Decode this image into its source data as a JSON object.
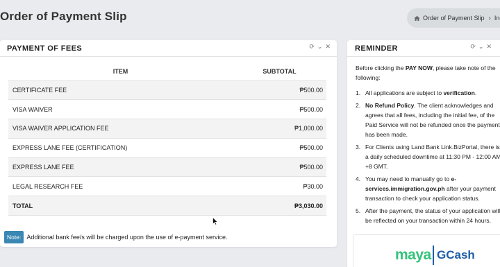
{
  "header": {
    "title": "Order of Payment Slip",
    "breadcrumb": [
      "Order of Payment Slip",
      "Inde"
    ]
  },
  "fees_panel": {
    "title": "PAYMENT OF FEES",
    "columns": [
      "ITEM",
      "SUBTOTAL"
    ],
    "rows": [
      {
        "item": "CERTIFICATE FEE",
        "subtotal": "₱500.00"
      },
      {
        "item": "VISA WAIVER",
        "subtotal": "₱500.00"
      },
      {
        "item": "VISA WAIVER APPLICATION FEE",
        "subtotal": "₱1,000.00"
      },
      {
        "item": "EXPRESS LANE FEE (CERTIFICATION)",
        "subtotal": "₱500.00"
      },
      {
        "item": "EXPRESS LANE FEE",
        "subtotal": "₱500.00"
      },
      {
        "item": "LEGAL RESEARCH FEE",
        "subtotal": "₱30.00"
      }
    ],
    "total": {
      "label": "TOTAL",
      "value": "₱3,030.00"
    },
    "note_badge": "Note:",
    "note_text": "Additional bank fee/s will be charged upon the use of e-payment service."
  },
  "reminder_panel": {
    "title": "REMINDER",
    "intro_a": "Before clicking the ",
    "intro_bold": "PAY NOW",
    "intro_b": ", please take note of the following:",
    "items": [
      {
        "num": "1.",
        "a": "All applications are subject to ",
        "b": "verification",
        "c": "."
      },
      {
        "num": "2.",
        "a": "",
        "b": "No Refund Policy",
        "c": ". The client acknowledges and agrees that all fees, including the initial fee, of the Paid Service will not be refunded once the payment has been made."
      },
      {
        "num": "3.",
        "a": "For Clients using Land Bank Link.BizPortal, there is a daily scheduled downtime at 11:30 PM - 12:00 AM +8 GMT.",
        "b": "",
        "c": ""
      },
      {
        "num": "4.",
        "a": "You may need to manually go to ",
        "b": "e-services.immigration.gov.ph",
        "c": " after your payment transaction to check your application status."
      },
      {
        "num": "5.",
        "a": "After the payment, the status of your application will be reflected on your transaction within 24 hours.",
        "b": "",
        "c": ""
      }
    ],
    "payment_logos": {
      "maya": "maya",
      "gcash": "GCash"
    }
  },
  "colors": {
    "note_badge": "#3a87b3",
    "maya": "#33c27a",
    "gcash": "#1f5ea8"
  }
}
